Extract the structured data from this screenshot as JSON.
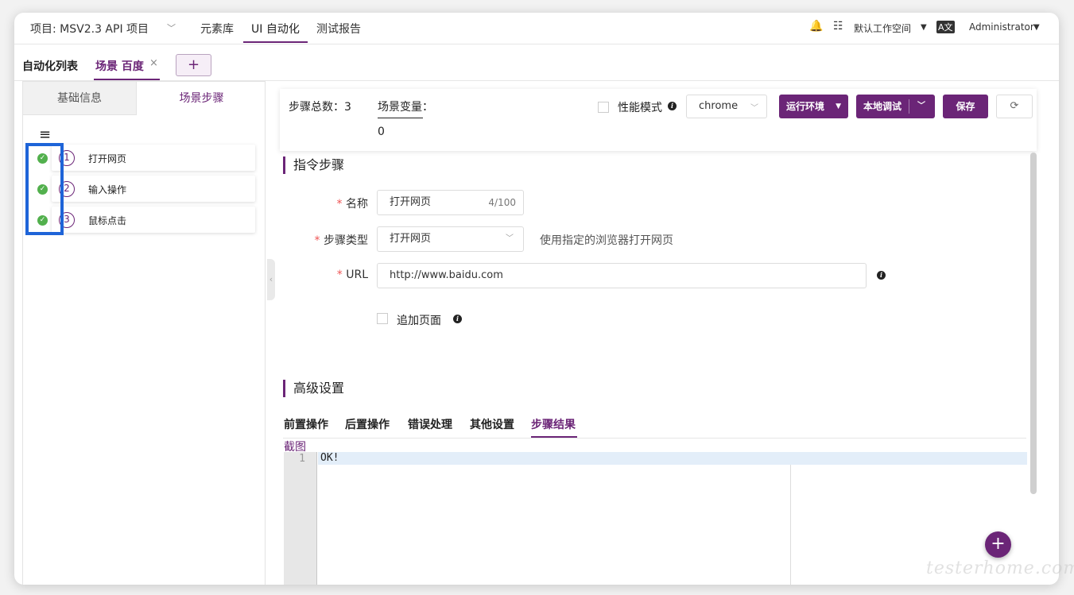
{
  "topbar": {
    "project": "项目: MSV2.3 API 项目",
    "nav": [
      "元素库",
      "UI 自动化",
      "测试报告"
    ],
    "workspace": "默认工作空间",
    "user": "Administrator"
  },
  "tabs": {
    "list": "自动化列表",
    "scene": "场景 百度",
    "close": "×",
    "add": "+"
  },
  "left": {
    "tab_basic": "基础信息",
    "tab_steps": "场景步骤",
    "menu": "≡",
    "steps": [
      {
        "num": "1",
        "label": "打开网页"
      },
      {
        "num": "2",
        "label": "输入操作"
      },
      {
        "num": "3",
        "label": "鼠标点击"
      }
    ]
  },
  "toolbar": {
    "total": "步骤总数：3",
    "var_label": "场景变量：",
    "var_value": "0",
    "perf_mode": "性能模式",
    "browser": "chrome",
    "run_env": "运行环境",
    "local_debug": "本地调试",
    "save": "保存"
  },
  "form": {
    "section_title": "指令步骤",
    "name_label": "名称",
    "name_value": "打开网页",
    "name_count": "4/100",
    "type_label": "步骤类型",
    "type_value": "打开网页",
    "type_hint": "使用指定的浏览器打开网页",
    "url_label": "URL",
    "url_value": "http://www.baidu.com",
    "append_label": "追加页面"
  },
  "advanced": {
    "title": "高级设置",
    "tabs": [
      "前置操作",
      "后置操作",
      "错误处理",
      "其他设置",
      "步骤结果"
    ],
    "active_tab": "步骤结果",
    "screenshot_label": "截图",
    "editor_line": "1",
    "editor_text": "OK!"
  },
  "watermark": "testerhome.com",
  "colors": {
    "accent": "#6b2577",
    "success": "#52b04d",
    "highlight": "#1e64d8"
  }
}
